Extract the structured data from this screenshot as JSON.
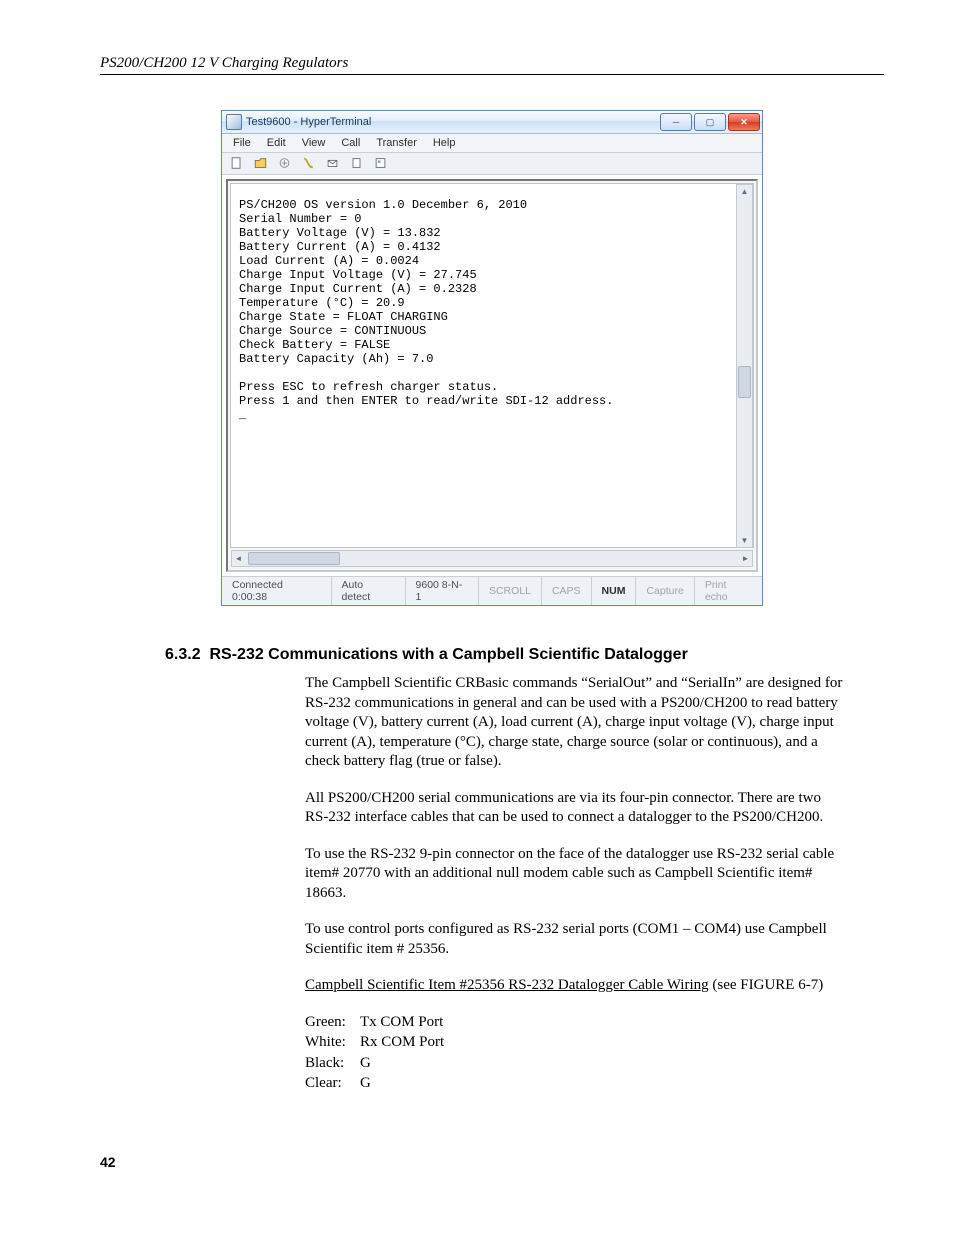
{
  "running_head": "PS200/CH200 12 V Charging Regulators",
  "page_number": "42",
  "hyperterminal": {
    "title": "Test9600 - HyperTerminal",
    "menu": [
      "File",
      "Edit",
      "View",
      "Call",
      "Transfer",
      "Help"
    ],
    "output": "PS/CH200 OS version 1.0 December 6, 2010\nSerial Number = 0\nBattery Voltage (V) = 13.832\nBattery Current (A) = 0.4132\nLoad Current (A) = 0.0024\nCharge Input Voltage (V) = 27.745\nCharge Input Current (A) = 0.2328\nTemperature (°C) = 20.9\nCharge State = FLOAT CHARGING\nCharge Source = CONTINUOUS\nCheck Battery = FALSE\nBattery Capacity (Ah) = 7.0\n\nPress ESC to refresh charger status.\nPress 1 and then ENTER to read/write SDI-12 address.\n_",
    "status": {
      "connected": "Connected 0:00:38",
      "detect": "Auto detect",
      "settings": "9600 8-N-1",
      "scroll": "SCROLL",
      "caps": "CAPS",
      "num": "NUM",
      "capture": "Capture",
      "printecho": "Print echo"
    }
  },
  "section": {
    "number": "6.3.2",
    "title": "RS-232 Communications with a Campbell Scientific Datalogger",
    "p1": "The Campbell Scientific CRBasic commands “SerialOut” and “SerialIn” are designed for RS-232 communications in general and can be used with a PS200/CH200 to read battery voltage (V), battery current (A), load current (A), charge input voltage (V), charge input current (A), temperature (°C), charge state, charge source (solar or continuous), and a check battery flag (true or false).",
    "p2": "All PS200/CH200 serial communications are via its four-pin connector.  There are two RS-232 interface cables that can be used to connect a datalogger to the PS200/CH200.",
    "p3": "To use the RS-232 9-pin connector on the face of the datalogger use RS-232 serial cable item# 20770 with an additional null modem cable such as Campbell Scientific item# 18663.",
    "p4": "To use control ports configured as RS-232 serial ports (COM1 – COM4) use Campbell Scientific item # 25356.",
    "wiring_head": "Campbell Scientific Item #25356 RS-232 Datalogger Cable Wiring",
    "wiring_tail": " (see FIGURE 6-7)",
    "wiring": [
      {
        "color": "Green:",
        "sig": "Tx COM Port"
      },
      {
        "color": "White:",
        "sig": "Rx COM Port"
      },
      {
        "color": "Black:",
        "sig": "G"
      },
      {
        "color": "Clear:",
        "sig": "G"
      }
    ]
  }
}
